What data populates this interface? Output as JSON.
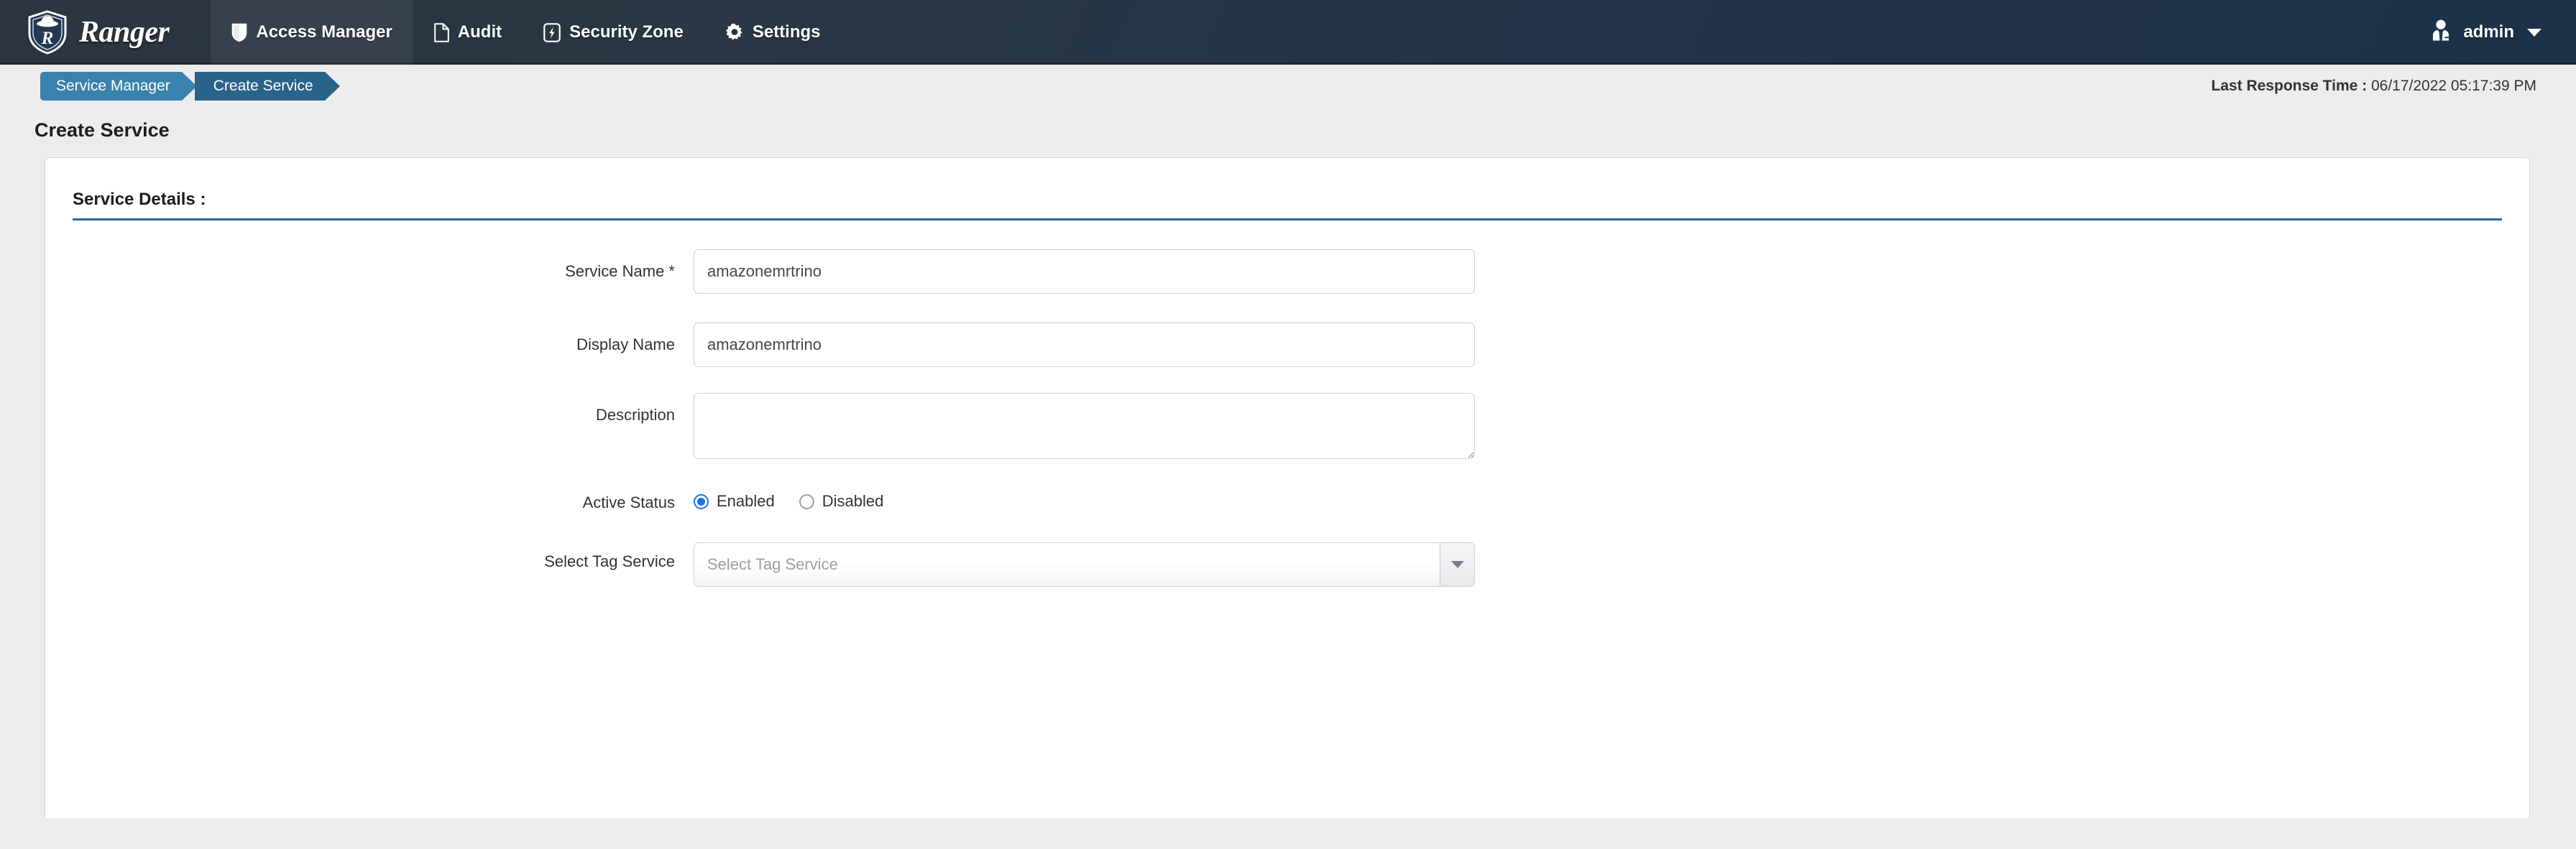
{
  "navbar": {
    "brand": {
      "name": "Ranger",
      "icon": "ranger-shield-logo"
    },
    "items": [
      {
        "label": "Access Manager",
        "icon": "shield-icon",
        "active": true
      },
      {
        "label": "Audit",
        "icon": "file-icon",
        "active": false
      },
      {
        "label": "Security Zone",
        "icon": "bolt-box-icon",
        "active": false
      },
      {
        "label": "Settings",
        "icon": "gear-icon",
        "active": false
      }
    ],
    "user": {
      "label": "admin",
      "icon": "user-tie-icon",
      "caret": "chevron-down-icon"
    }
  },
  "breadcrumb": {
    "items": [
      {
        "label": "Service Manager",
        "color": "#3a82ad"
      },
      {
        "label": "Create Service",
        "color": "#2a6389"
      }
    ]
  },
  "response_time": {
    "label": "Last Response Time :",
    "value": "06/17/2022 05:17:39 PM"
  },
  "page": {
    "title": "Create Service"
  },
  "service_details": {
    "heading": "Service Details :",
    "accent_color": "#2b6c9b",
    "fields": {
      "service_name": {
        "label": "Service Name *",
        "value": "amazonemrtrino",
        "placeholder": ""
      },
      "display_name": {
        "label": "Display Name",
        "value": "amazonemrtrino",
        "placeholder": ""
      },
      "description": {
        "label": "Description",
        "value": "",
        "placeholder": ""
      },
      "active_status": {
        "label": "Active Status",
        "selected": "Enabled",
        "options": [
          {
            "label": "Enabled",
            "checked": true
          },
          {
            "label": "Disabled",
            "checked": false
          }
        ]
      },
      "select_tag_service": {
        "label": "Select Tag Service",
        "value": "",
        "placeholder": "Select Tag Service",
        "caret": "caret-down-icon"
      }
    }
  }
}
